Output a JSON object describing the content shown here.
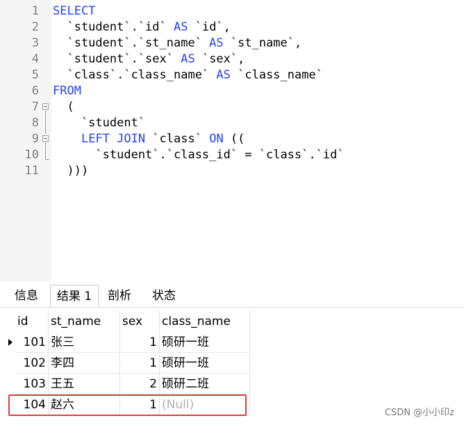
{
  "editor": {
    "lines": [
      {
        "n": "1",
        "parts": [
          {
            "t": "SELECT",
            "k": true
          }
        ]
      },
      {
        "n": "2",
        "parts": [
          {
            "t": "  `student`.`id` "
          },
          {
            "t": "AS",
            "k": true
          },
          {
            "t": " `id`,"
          }
        ]
      },
      {
        "n": "3",
        "parts": [
          {
            "t": "  `student`.`st_name` "
          },
          {
            "t": "AS",
            "k": true
          },
          {
            "t": " `st_name`,"
          }
        ]
      },
      {
        "n": "4",
        "parts": [
          {
            "t": "  `student`.`sex` "
          },
          {
            "t": "AS",
            "k": true
          },
          {
            "t": " `sex`,"
          }
        ]
      },
      {
        "n": "5",
        "parts": [
          {
            "t": "  `class`.`class_name` "
          },
          {
            "t": "AS",
            "k": true
          },
          {
            "t": " `class_name`"
          }
        ]
      },
      {
        "n": "6",
        "parts": [
          {
            "t": "FROM",
            "k": true
          }
        ]
      },
      {
        "n": "7",
        "parts": [
          {
            "t": "  ("
          }
        ]
      },
      {
        "n": "8",
        "parts": [
          {
            "t": "    `student`"
          }
        ]
      },
      {
        "n": "9",
        "parts": [
          {
            "t": "    "
          },
          {
            "t": "LEFT JOIN",
            "k": true
          },
          {
            "t": " `class` "
          },
          {
            "t": "ON",
            "k": true
          },
          {
            "t": " (("
          }
        ]
      },
      {
        "n": "10",
        "parts": [
          {
            "t": "      `student`.`class_id` = `class`.`id`"
          }
        ]
      },
      {
        "n": "11",
        "parts": [
          {
            "t": "  )))"
          }
        ]
      }
    ]
  },
  "tabs": [
    {
      "label": "信息",
      "active": false
    },
    {
      "label": "结果 1",
      "active": true
    },
    {
      "label": "剖析",
      "active": false
    },
    {
      "label": "状态",
      "active": false
    }
  ],
  "grid": {
    "columns": [
      "id",
      "st_name",
      "sex",
      "class_name"
    ],
    "rows": [
      {
        "id": "101",
        "st_name": "张三",
        "sex": "1",
        "class_name": "硕研一班"
      },
      {
        "id": "102",
        "st_name": "李四",
        "sex": "1",
        "class_name": "硕研一班"
      },
      {
        "id": "103",
        "st_name": "王五",
        "sex": "2",
        "class_name": "硕研二班"
      },
      {
        "id": "104",
        "st_name": "赵六",
        "sex": "1",
        "class_name": "(Null)"
      }
    ],
    "current_row": 0,
    "highlighted_row": 3
  },
  "watermark": "CSDN @小小印z",
  "colors": {
    "keyword": "#1f3fff",
    "highlight": "#e0393b",
    "null_text": "#b0b0b0"
  }
}
